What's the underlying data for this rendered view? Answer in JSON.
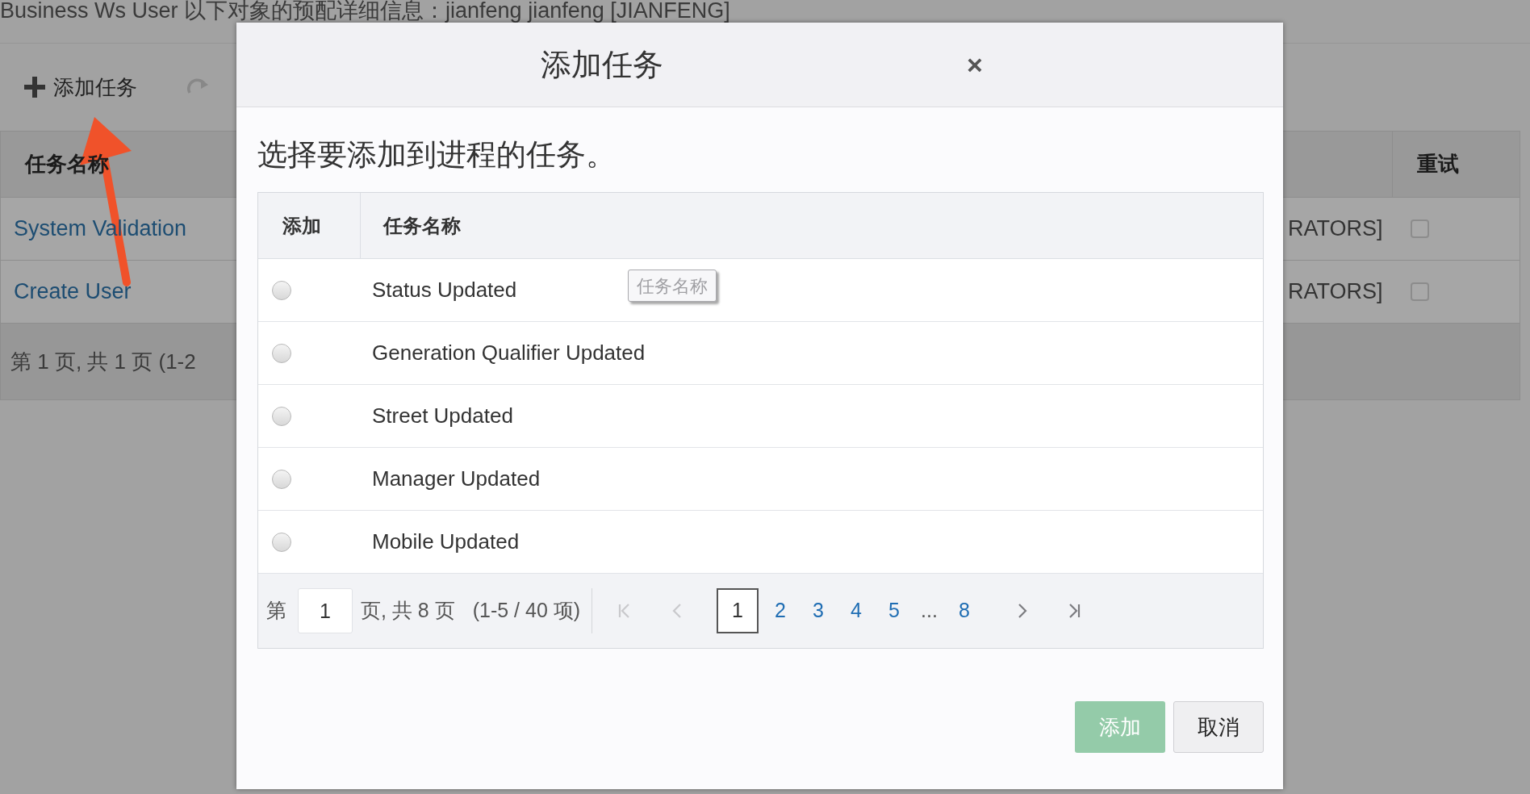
{
  "page": {
    "title": "Business Ws User 以下对象的预配详细信息：jianfeng jianfeng [JIANFENG]",
    "toolbar": {
      "add_label": "添加任务"
    },
    "table": {
      "columns": [
        "任务名称",
        "重试"
      ],
      "rows": [
        {
          "task_name": "System Validation",
          "column_2": "RATORS]",
          "retry_checked": false
        },
        {
          "task_name": "Create User",
          "column_2": "RATORS]",
          "retry_checked": false
        }
      ],
      "pagination": "第 1 页, 共 1 页 (1-2"
    }
  },
  "dialog": {
    "title": "添加任务",
    "close": "×",
    "instruction": "选择要添加到进程的任务。",
    "table": {
      "columns": [
        "添加",
        "任务名称"
      ],
      "rows": [
        {
          "name": "Status Updated",
          "selected": false
        },
        {
          "name": "Generation Qualifier Updated",
          "selected": false
        },
        {
          "name": "Street Updated",
          "selected": false
        },
        {
          "name": "Manager Updated",
          "selected": false
        },
        {
          "name": "Mobile Updated",
          "selected": false
        }
      ]
    },
    "tooltip": "任务名称",
    "pagination": {
      "prefix": "第",
      "page_input": "1",
      "page_info": "页, 共 8 页",
      "range": "(1-5 / 40 项)",
      "nav": [
        {
          "kind": "first",
          "disabled": true
        },
        {
          "kind": "prev",
          "disabled": true
        },
        {
          "kind": "next",
          "disabled": false
        },
        {
          "kind": "last",
          "disabled": false
        }
      ],
      "pages": [
        {
          "label": "1",
          "kind": "page",
          "selected": true
        },
        {
          "label": "2",
          "kind": "page",
          "selected": false
        },
        {
          "label": "3",
          "kind": "page",
          "selected": false
        },
        {
          "label": "4",
          "kind": "page",
          "selected": false
        },
        {
          "label": "5",
          "kind": "page",
          "selected": false
        },
        {
          "label": "...",
          "kind": "ellipsis"
        },
        {
          "label": "8",
          "kind": "page",
          "selected": false
        }
      ]
    },
    "buttons": [
      {
        "label": "添加",
        "kind": "primary",
        "disabled": true
      },
      {
        "label": "取消",
        "kind": "secondary",
        "disabled": false
      }
    ]
  }
}
